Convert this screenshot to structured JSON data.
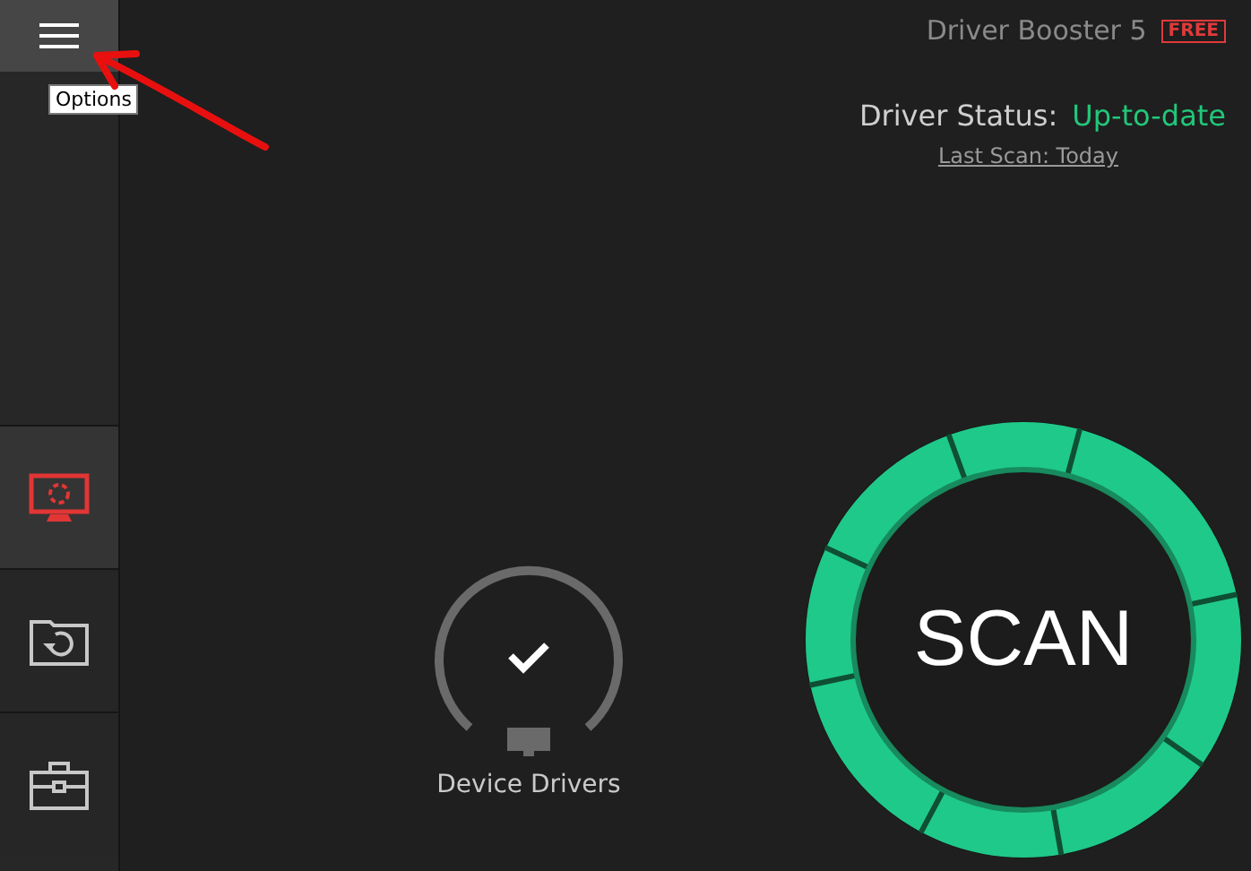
{
  "window": {
    "title": "Driver Booster 5",
    "edition_badge": "FREE"
  },
  "menu_button": {
    "tooltip": "Options"
  },
  "sidebar": {
    "items": [
      {
        "selected": true
      },
      {
        "selected": false
      },
      {
        "selected": false
      }
    ]
  },
  "status": {
    "label": "Driver Status:",
    "value": "Up-to-date",
    "last_scan": "Last Scan: Today"
  },
  "device_drivers": {
    "label": "Device Drivers"
  },
  "scan_button": {
    "label": "SCAN"
  }
}
